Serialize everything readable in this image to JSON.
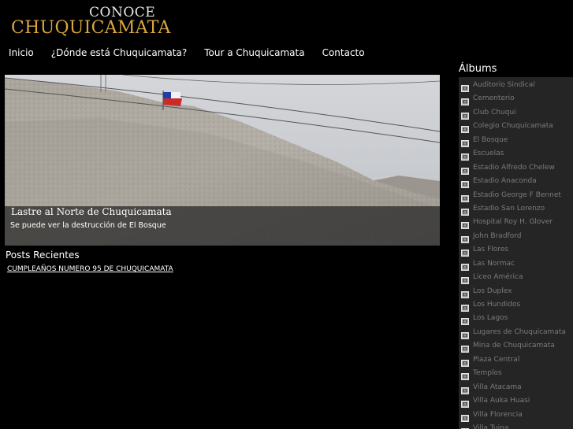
{
  "brand": {
    "top": "CONOCE",
    "main": "CHUQUICAMATA"
  },
  "nav": [
    {
      "label": "Inicio"
    },
    {
      "label": "¿Dónde está Chuquicamata?"
    },
    {
      "label": "Tour a Chuquicamata"
    },
    {
      "label": "Contacto"
    }
  ],
  "slide": {
    "title": "Lastre al Norte de Chuquicamata",
    "subtitle": "Se puede ver la destrucción de El Bosque"
  },
  "posts": {
    "heading": "Posts Recientes",
    "items": [
      {
        "label": "CUMPLEAÑOS NUMERO 95 DE CHUQUICAMATA"
      }
    ]
  },
  "albums": {
    "heading": "Álbums",
    "items": [
      {
        "label": "Auditorio Sindical"
      },
      {
        "label": "Cementerio"
      },
      {
        "label": "Club Chuqui"
      },
      {
        "label": "Colegio Chuquicamata"
      },
      {
        "label": "El Bosque"
      },
      {
        "label": "Escuelas"
      },
      {
        "label": "Estadio Alfredo Chelew"
      },
      {
        "label": "Estadio Anaconda"
      },
      {
        "label": "Estadio George F Bennet"
      },
      {
        "label": "Estadio San Lorenzo"
      },
      {
        "label": "Hospital Roy H. Glover"
      },
      {
        "label": "John Bradford"
      },
      {
        "label": "Las Flores"
      },
      {
        "label": "Las Normac"
      },
      {
        "label": "Liceo América"
      },
      {
        "label": "Los Duplex"
      },
      {
        "label": "Los Hundidos"
      },
      {
        "label": "Los Lagos"
      },
      {
        "label": "Lugares de Chuquicamata"
      },
      {
        "label": "Mina de Chuquicamata"
      },
      {
        "label": "Plaza Central"
      },
      {
        "label": "Templos"
      },
      {
        "label": "Villa Atacama"
      },
      {
        "label": "Villa Auka Huasi"
      },
      {
        "label": "Villa Florencia"
      },
      {
        "label": "Villa Tuina"
      }
    ]
  },
  "colors": {
    "background": "#000000",
    "brand_gold": "#d9a640",
    "album_text": "#7b7b7b",
    "panel": "#252525"
  }
}
